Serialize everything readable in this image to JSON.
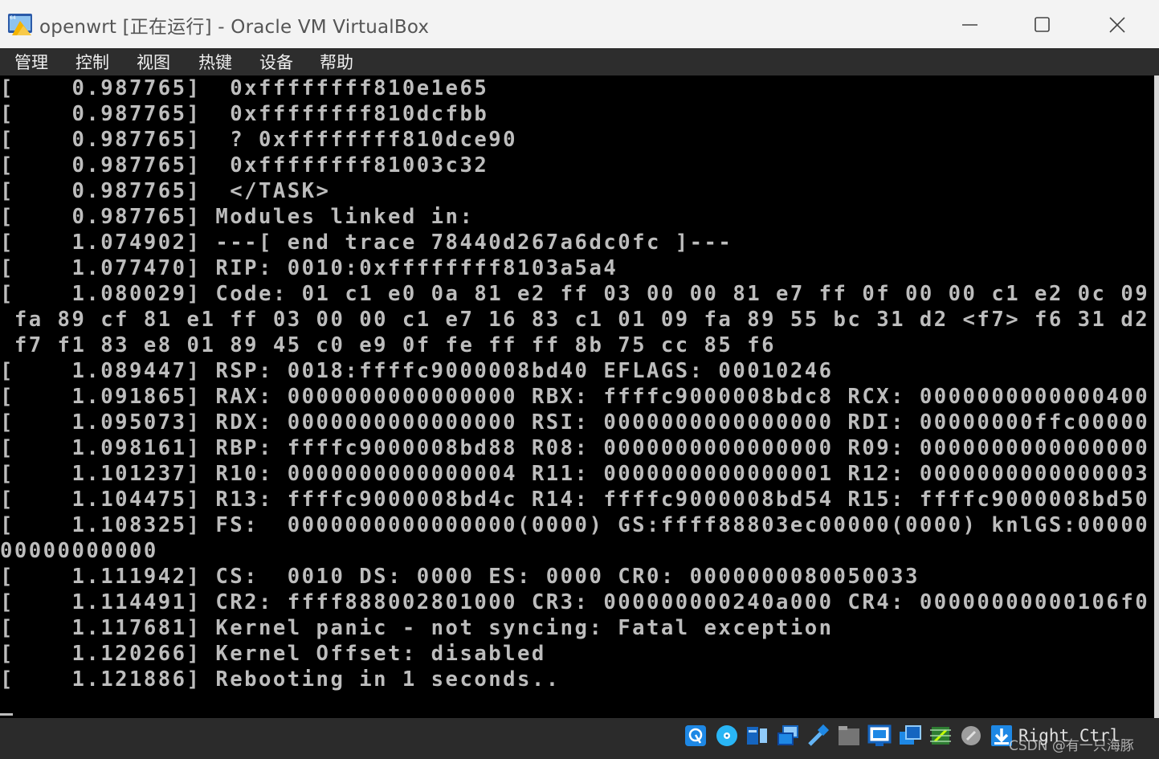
{
  "window": {
    "title": "openwrt [正在运行] - Oracle VM VirtualBox",
    "icon": "virtualbox-app-icon",
    "controls": [
      "minimize-icon",
      "maximize-icon",
      "close-icon"
    ]
  },
  "menu": {
    "items": [
      "管理",
      "控制",
      "视图",
      "热键",
      "设备",
      "帮助"
    ]
  },
  "console": {
    "lines": [
      "[    0.987765]  0xffffffff810e1e65",
      "[    0.987765]  0xffffffff810dcfbb",
      "[    0.987765]  ? 0xffffffff810dce90",
      "[    0.987765]  0xffffffff81003c32",
      "[    0.987765]  </TASK>",
      "[    0.987765] Modules linked in:",
      "[    1.074902] ---[ end trace 78440d267a6dc0fc ]---",
      "[    1.077470] RIP: 0010:0xffffffff8103a5a4",
      "[    1.080029] Code: 01 c1 e0 0a 81 e2 ff 03 00 00 81 e7 ff 0f 00 00 c1 e2 0c 09",
      " fa 89 cf 81 e1 ff 03 00 00 c1 e7 16 83 c1 01 09 fa 89 55 bc 31 d2 <f7> f6 31 d2",
      " f7 f1 83 e8 01 89 45 c0 e9 0f fe ff ff 8b 75 cc 85 f6",
      "[    1.089447] RSP: 0018:ffffc9000008bd40 EFLAGS: 00010246",
      "[    1.091865] RAX: 0000000000000000 RBX: ffffc9000008bdc8 RCX: 0000000000000400",
      "[    1.095073] RDX: 0000000000000000 RSI: 0000000000000000 RDI: 00000000ffc00000",
      "[    1.098161] RBP: ffffc9000008bd88 R08: 0000000000000000 R09: 0000000000000000",
      "[    1.101237] R10: 0000000000000004 R11: 0000000000000001 R12: 0000000000000003",
      "[    1.104475] R13: ffffc9000008bd4c R14: ffffc9000008bd54 R15: ffffc9000008bd50",
      "[    1.108325] FS:  0000000000000000(0000) GS:ffff88803ec00000(0000) knlGS:00000",
      "00000000000",
      "[    1.111942] CS:  0010 DS: 0000 ES: 0000 CR0: 0000000080050033",
      "[    1.114491] CR2: ffff888002801000 CR3: 000000000240a000 CR4: 00000000000106f0",
      "[    1.117681] Kernel panic - not syncing: Fatal exception",
      "[    1.120266] Kernel Offset: disabled",
      "[    1.121886] Rebooting in 1 seconds.."
    ]
  },
  "statusbar": {
    "icons": [
      "hard-disk-icon",
      "optical-drive-icon",
      "audio-icon",
      "network-icon",
      "usb-icon",
      "shared-folders-icon",
      "display-icon",
      "video-capture-icon",
      "cpu-icon",
      "mouse-integration-icon",
      "host-key-arrow-icon"
    ],
    "host_key": "Right Ctrl",
    "watermark": "CSDN @有一只海豚"
  }
}
